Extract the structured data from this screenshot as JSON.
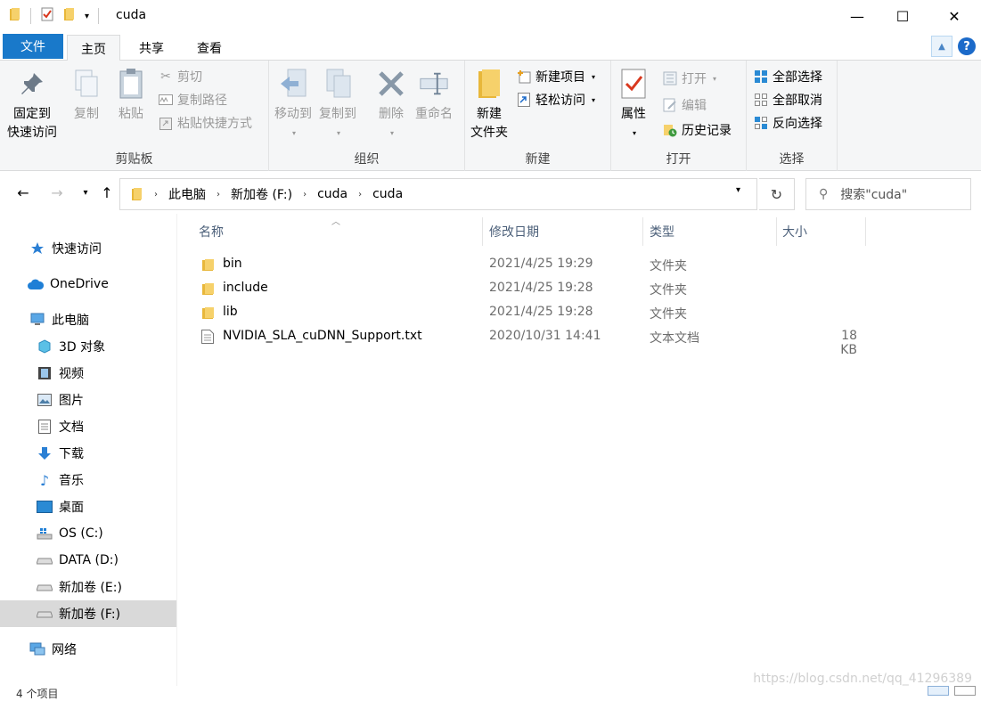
{
  "window": {
    "title": "cuda",
    "minimize": "—",
    "maximize": "☐",
    "close": "✕"
  },
  "ribbon_tabs": [
    {
      "label": "文件"
    },
    {
      "label": "主页"
    },
    {
      "label": "共享"
    },
    {
      "label": "查看"
    }
  ],
  "ribbon": {
    "clipboard": {
      "group_label": "剪贴板",
      "pin_label_1": "固定到",
      "pin_label_2": "快速访问",
      "copy": "复制",
      "paste": "粘贴",
      "cut": "剪切",
      "copy_path": "复制路径",
      "paste_shortcut": "粘贴快捷方式"
    },
    "organize": {
      "group_label": "组织",
      "move_to": "移动到",
      "copy_to": "复制到",
      "delete": "删除",
      "rename": "重命名"
    },
    "new": {
      "group_label": "新建",
      "new_folder_1": "新建",
      "new_folder_2": "文件夹",
      "new_item": "新建项目",
      "easy_access": "轻松访问"
    },
    "open": {
      "group_label": "打开",
      "properties": "属性",
      "open": "打开",
      "edit": "编辑",
      "history": "历史记录"
    },
    "select": {
      "group_label": "选择",
      "select_all": "全部选择",
      "select_none": "全部取消",
      "invert": "反向选择"
    }
  },
  "address": {
    "crumbs": [
      "此电脑",
      "新加卷 (F:)",
      "cuda",
      "cuda"
    ],
    "search_placeholder": "搜索\"cuda\""
  },
  "nav_pane": [
    {
      "label": "快速访问",
      "icon": "star-icon"
    },
    {
      "label": "OneDrive",
      "icon": "cloud-icon"
    },
    {
      "label": "此电脑",
      "icon": "computer-icon"
    },
    {
      "label": "3D 对象",
      "icon": "cube-icon"
    },
    {
      "label": "视频",
      "icon": "video-icon"
    },
    {
      "label": "图片",
      "icon": "picture-icon"
    },
    {
      "label": "文档",
      "icon": "document-icon"
    },
    {
      "label": "下载",
      "icon": "download-icon"
    },
    {
      "label": "音乐",
      "icon": "music-icon"
    },
    {
      "label": "桌面",
      "icon": "desktop-icon"
    },
    {
      "label": "OS (C:)",
      "icon": "windows-drive-icon"
    },
    {
      "label": "DATA (D:)",
      "icon": "drive-icon"
    },
    {
      "label": "新加卷 (E:)",
      "icon": "drive-icon"
    },
    {
      "label": "新加卷 (F:)",
      "icon": "drive-icon"
    },
    {
      "label": "网络",
      "icon": "network-icon"
    }
  ],
  "columns": {
    "name": "名称",
    "date": "修改日期",
    "type": "类型",
    "size": "大小"
  },
  "files": [
    {
      "name": "bin",
      "date": "2021/4/25 19:29",
      "type": "文件夹",
      "size": "",
      "icon": "folder-icon"
    },
    {
      "name": "include",
      "date": "2021/4/25 19:28",
      "type": "文件夹",
      "size": "",
      "icon": "folder-icon"
    },
    {
      "name": "lib",
      "date": "2021/4/25 19:28",
      "type": "文件夹",
      "size": "",
      "icon": "folder-icon"
    },
    {
      "name": "NVIDIA_SLA_cuDNN_Support.txt",
      "date": "2020/10/31 14:41",
      "type": "文本文档",
      "size": "18 KB",
      "icon": "text-file-icon"
    }
  ],
  "status": {
    "item_count": "4 个项目"
  },
  "watermark": "https://blog.csdn.net/qq_41296389"
}
